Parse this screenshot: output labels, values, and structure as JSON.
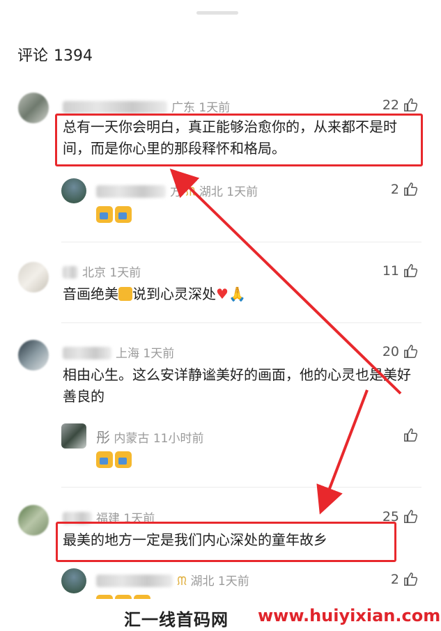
{
  "header": {
    "label": "评论",
    "count": "1394"
  },
  "comments": [
    {
      "location": "广东",
      "time": "1天前",
      "likes": "22",
      "text": "总有一天你会明白，真正能够治愈你的，从来都不是时间，而是你心里的那段释怀和格局。"
    },
    {
      "location": "湖北",
      "time": "1天前",
      "likes": "2",
      "name_suffix": "方"
    },
    {
      "location": "北京",
      "time": "1天前",
      "likes": "11",
      "text": "音画绝美",
      "text2": "说到心灵深处"
    },
    {
      "location": "上海",
      "time": "1天前",
      "likes": "20",
      "text": "相由心生。这么安详静谧美好的画面，他的心灵也是美好善良的"
    },
    {
      "name": "彤",
      "location": "内蒙古",
      "time": "11小时前",
      "likes": ""
    },
    {
      "location": "福建",
      "time": "1天前",
      "likes": "25",
      "text": "最美的地方一定是我们内心深处的童年故乡"
    },
    {
      "location": "湖北",
      "time": "1天前",
      "likes": "2"
    }
  ],
  "watermark": {
    "cn": "汇一线首码网",
    "url": "www.huiyixian.com"
  },
  "colors": {
    "highlight": "#e8282c",
    "meta": "#9a9a9a"
  }
}
